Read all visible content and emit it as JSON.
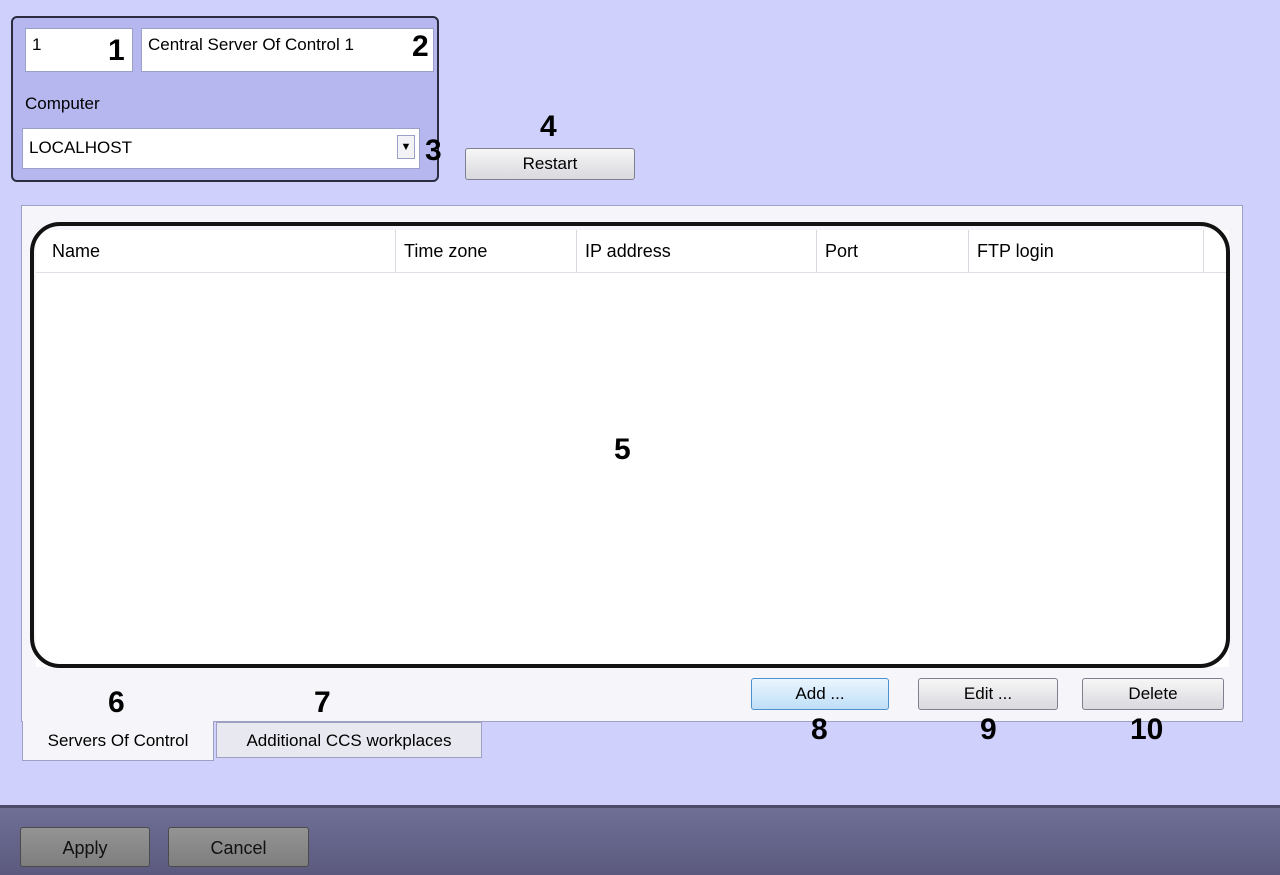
{
  "settings": {
    "id_value": "1",
    "name_value": "Central Server Of Control 1",
    "computer_label": "Computer",
    "computer_value": "LOCALHOST",
    "restart_label": "Restart"
  },
  "table": {
    "columns": [
      "Name",
      "Time zone",
      "IP address",
      "Port",
      "FTP login"
    ],
    "rows": []
  },
  "actions": {
    "add_label": "Add ...",
    "edit_label": "Edit ...",
    "delete_label": "Delete"
  },
  "tabs": [
    {
      "label": "Servers Of Control",
      "active": true
    },
    {
      "label": "Additional CCS workplaces",
      "active": false
    }
  ],
  "footer": {
    "apply_label": "Apply",
    "cancel_label": "Cancel"
  },
  "callouts": [
    "1",
    "2",
    "3",
    "4",
    "5",
    "6",
    "7",
    "8",
    "9",
    "10"
  ],
  "colors": {
    "panel_bg": "#cfd0fb",
    "group_bg": "#b6b7ee",
    "footer_bg": "#6f6e95",
    "add_highlight": "#bfdff7"
  }
}
